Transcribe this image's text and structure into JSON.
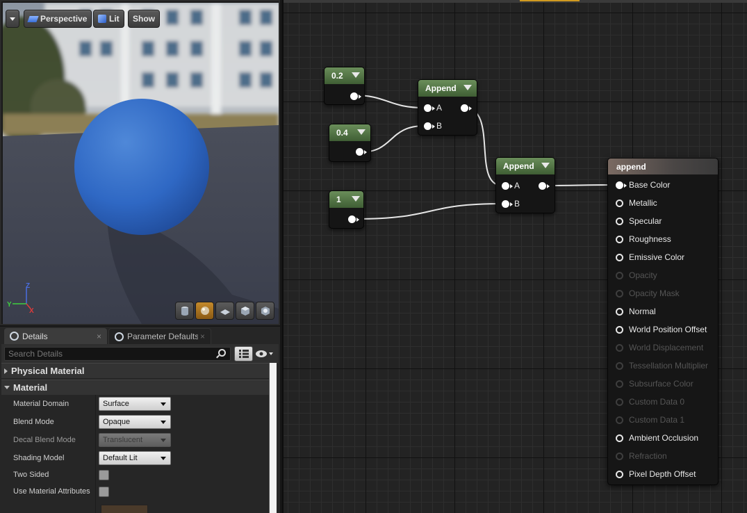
{
  "viewport": {
    "menu_icon": "chevron-down-icon",
    "perspective_label": "Perspective",
    "lit_label": "Lit",
    "show_label": "Show",
    "axis_z": "Z",
    "axis_y": "Y",
    "axis_x": "X",
    "tools": [
      "cylinder-preview-icon",
      "sphere-preview-icon",
      "plane-preview-icon",
      "cube-preview-icon",
      "custom-mesh-icon"
    ]
  },
  "details": {
    "tab_details": "Details",
    "tab_params": "Parameter Defaults",
    "search_placeholder": "Search Details",
    "categories": {
      "physical": "Physical Material",
      "material": "Material"
    },
    "props": [
      {
        "label": "Material Domain",
        "value": "Surface"
      },
      {
        "label": "Blend Mode",
        "value": "Opaque"
      },
      {
        "label": "Decal Blend Mode",
        "value": "Translucent"
      },
      {
        "label": "Shading Model",
        "value": "Default Lit"
      },
      {
        "label": "Two Sided",
        "value": ""
      },
      {
        "label": "Use Material Attributes",
        "value": ""
      }
    ]
  },
  "graph": {
    "const_nodes": [
      "0.2",
      "0.4",
      "1"
    ],
    "append1": {
      "title": "Append",
      "a": "A",
      "b": "B"
    },
    "append2": {
      "title": "Append",
      "a": "A",
      "b": "B"
    },
    "material": {
      "title": "append",
      "inputs": [
        {
          "label": "Base Color",
          "state": "connected"
        },
        {
          "label": "Metallic",
          "state": "enabled"
        },
        {
          "label": "Specular",
          "state": "enabled"
        },
        {
          "label": "Roughness",
          "state": "enabled"
        },
        {
          "label": "Emissive Color",
          "state": "enabled"
        },
        {
          "label": "Opacity",
          "state": "disabled"
        },
        {
          "label": "Opacity Mask",
          "state": "disabled"
        },
        {
          "label": "Normal",
          "state": "enabled"
        },
        {
          "label": "World Position Offset",
          "state": "enabled"
        },
        {
          "label": "World Displacement",
          "state": "disabled"
        },
        {
          "label": "Tessellation Multiplier",
          "state": "disabled"
        },
        {
          "label": "Subsurface Color",
          "state": "disabled"
        },
        {
          "label": "Custom Data 0",
          "state": "disabled"
        },
        {
          "label": "Custom Data 1",
          "state": "disabled"
        },
        {
          "label": "Ambient Occlusion",
          "state": "enabled"
        },
        {
          "label": "Refraction",
          "state": "disabled"
        },
        {
          "label": "Pixel Depth Offset",
          "state": "enabled"
        }
      ]
    }
  }
}
